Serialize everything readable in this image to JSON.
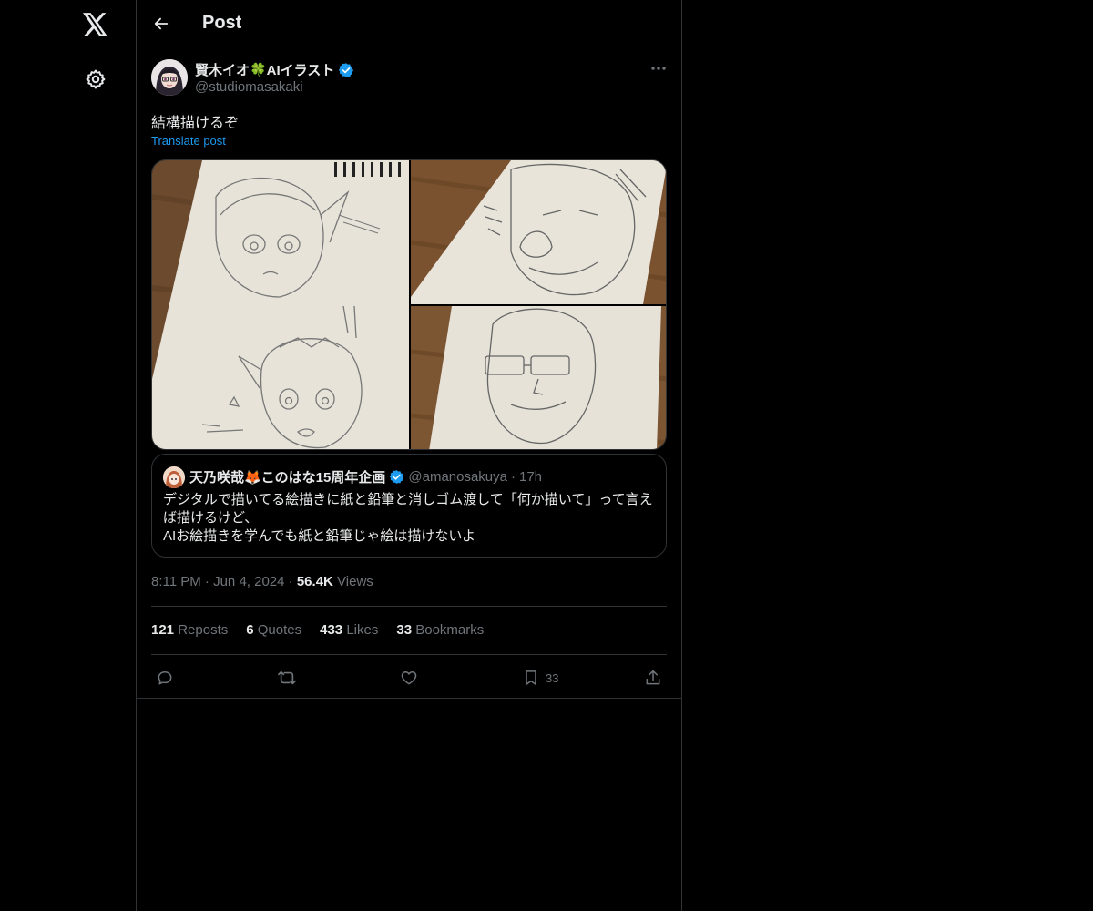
{
  "header": {
    "title": "Post"
  },
  "post": {
    "author_name": "賢木イオ🍀AIイラスト",
    "author_handle": "@studiomasakaki",
    "text": "結構描けるぞ",
    "translate_label": "Translate post",
    "time": "8:11 PM",
    "date": "Jun 4, 2024",
    "views_count": "56.4K",
    "views_label": "Views",
    "separator": "·"
  },
  "quote": {
    "name": "天乃咲哉🦊このはな15周年企画",
    "handle": "@amanosakuya",
    "separator": "·",
    "time": "17h",
    "line1": "デジタルで描いてる絵描きに紙と鉛筆と消しゴム渡して「何か描いて」って言えば描けるけど、",
    "line2": "AIお絵描きを学んでも紙と鉛筆じゃ絵は描けないよ"
  },
  "stats": {
    "reposts_count": "121",
    "reposts_label": "Reposts",
    "quotes_count": "6",
    "quotes_label": "Quotes",
    "likes_count": "433",
    "likes_label": "Likes",
    "bookmarks_count": "33",
    "bookmarks_label": "Bookmarks"
  },
  "actions": {
    "bookmark_count": "33"
  },
  "colors": {
    "background": "#000000",
    "text": "#e7e9ea",
    "muted": "#71767b",
    "accent": "#1d9bf0",
    "border": "#2f3336"
  },
  "icons": [
    "x-logo-icon",
    "gear-icon",
    "back-arrow-icon",
    "verified-badge-icon",
    "more-icon",
    "reply-icon",
    "repost-icon",
    "like-icon",
    "bookmark-icon",
    "share-icon"
  ]
}
